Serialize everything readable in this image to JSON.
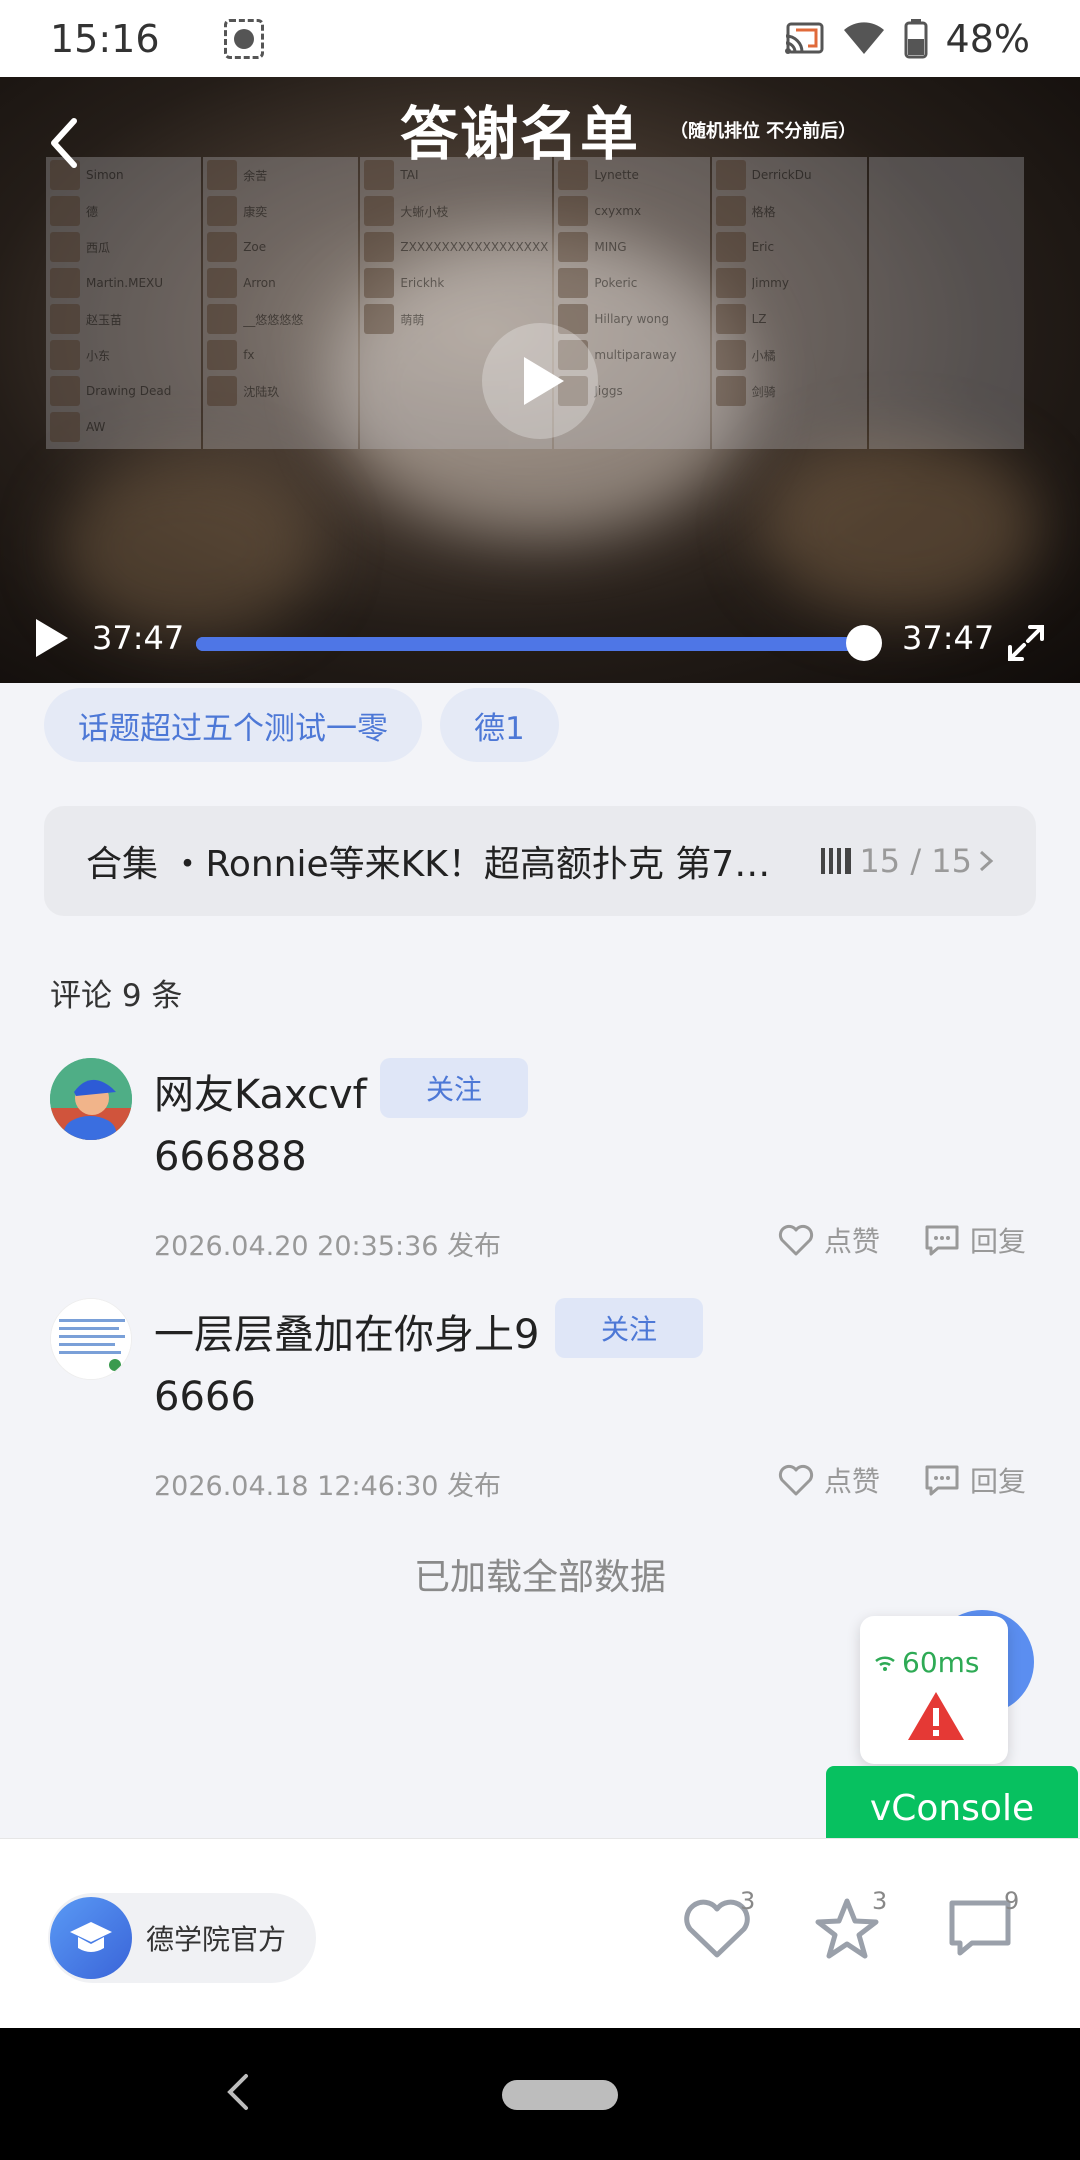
{
  "status_bar": {
    "time": "15:16",
    "battery": "48%"
  },
  "video": {
    "title": "答谢名单",
    "subtitle": "（随机排位  不分前后）",
    "credit_names": [
      "Simon",
      "德",
      "西瓜",
      "Martin.MEXU",
      "赵玉苗",
      "小东",
      "Drawing Dead",
      "AW",
      "余苦",
      "康奕",
      "Zoe",
      "Arron",
      "__悠悠悠悠",
      "fx",
      "沈陆玖",
      "TAI",
      "大蜥小枝",
      "ZXXXXXXXXXXXXXXXXX",
      "Erickhk",
      "萌萌",
      "Lynette",
      "cxyxmx",
      "MING",
      "Pokeric",
      "Hillary wong",
      "multiparaway",
      "Jiggs",
      "DerrickDu",
      "格格",
      "Eric",
      "Jimmy",
      "LZ",
      "小橘",
      "剑骑"
    ],
    "current_time": "37:47",
    "duration": "37:47",
    "progress": 1.0
  },
  "tags": [
    "话题超过五个测试一零",
    "德1"
  ],
  "collection": {
    "label": "合集 ・Ronnie等来KK！超高额扑克 第7…",
    "progress": "15 / 15"
  },
  "comments_header": "评论 9 条",
  "comments": [
    {
      "name": "网友Kaxcvf",
      "follow": "关注",
      "text": "666888",
      "time": "2026.04.20 20:35:36 发布",
      "like": "点赞",
      "reply": "回复"
    },
    {
      "name": "一层层叠加在你身上9",
      "follow": "关注",
      "text": "6666",
      "time": "2026.04.18 12:46:30 发布",
      "like": "点赞",
      "reply": "回复"
    }
  ],
  "load_all": "已加载全部数据",
  "latency": "60ms",
  "vconsole": "vConsole",
  "bottom_bar": {
    "author": "德学院官方",
    "likes": "3",
    "favorites": "3",
    "comments": "9"
  },
  "colors": {
    "accent": "#4d78d6",
    "progress": "#4e76e6",
    "vconsole": "#07c160"
  }
}
